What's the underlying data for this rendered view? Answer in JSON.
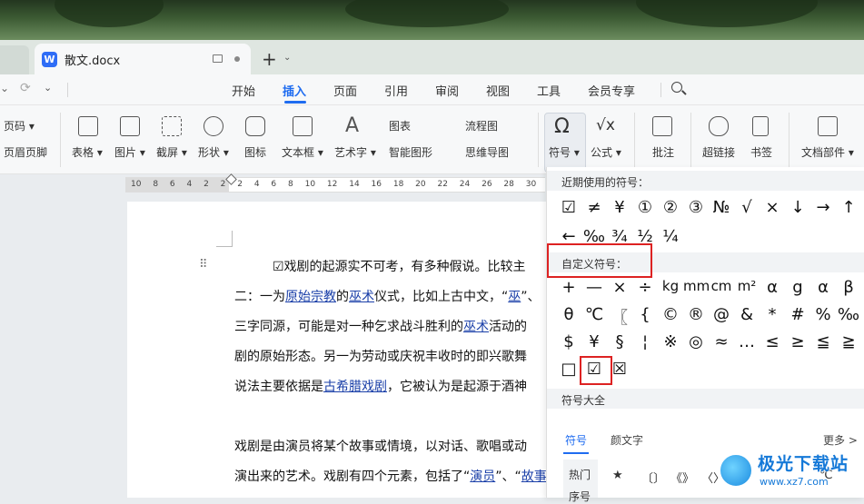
{
  "tab": {
    "app_letter": "W",
    "title": "散文.docx",
    "new_tab": "+",
    "new_tab_arrow": "⌄"
  },
  "menu": {
    "undo": "⌄",
    "redo": "⟳",
    "more": "⌄",
    "items": [
      "开始",
      "插入",
      "页面",
      "引用",
      "审阅",
      "视图",
      "工具",
      "会员专享"
    ],
    "active": "插入"
  },
  "ribbon": {
    "page_num": "页码 ▾",
    "header_footer": "页眉页脚",
    "table": "表格 ▾",
    "picture": "图片 ▾",
    "screenshot": "截屏 ▾",
    "shape": "形状 ▾",
    "icon": "图标",
    "textbox": "文本框 ▾",
    "wordart": "艺术字 ▾",
    "chart": "图表",
    "smartart": "智能图形",
    "flowchart": "流程图",
    "mindmap": "思维导图",
    "symbol": "符号 ▾",
    "formula": "公式 ▾",
    "comment": "批注",
    "hyperlink": "超链接",
    "bookmark": "书签",
    "doc_parts": "文档部件 ▾"
  },
  "ruler": {
    "numbers": "10 8 6 4 2 2 2 4 6 8 10 12 14 16 18 20 22 24 26 28 30 32"
  },
  "document": {
    "line1": "☑戏剧的起源实不可考，有多种假说。比较主",
    "line2_pre": "二：一为",
    "line2_link1": "原始宗教",
    "line2_mid": "的",
    "line2_link2": "巫术",
    "line2_post": "仪式，比如上古中文，“",
    "line2_link3": "巫",
    "line2_end": "”、",
    "line3_pre": "三字同源，可能是对一种乞求战斗胜利的",
    "line3_link": "巫术",
    "line3_post": "活动的",
    "line4": "剧的原始形态。另一为劳动或庆祝丰收时的即兴歌舞",
    "line5_pre": "说法主要依据是",
    "line5_link": "古希腊戏剧",
    "line5_post": "，它被认为是起源于酒神",
    "line6": "戏剧是由演员将某个故事或情境，以对话、歌唱或动",
    "line7_pre": "演出来的艺术。戏剧有四个元素，包括了“",
    "line7_link1": "演员",
    "line7_mid": "”、“",
    "line7_link2": "故事"
  },
  "panel": {
    "recent_title": "近期使用的符号：",
    "recent_row1": [
      "☑",
      "≠",
      "¥",
      "①",
      "②",
      "③",
      "№",
      "√",
      "×",
      "↓",
      "→",
      "↑"
    ],
    "recent_row2": [
      "←",
      "‰",
      "¾",
      "½",
      "¼"
    ],
    "custom_title": "自定义符号：",
    "custom_row1": [
      "+",
      "—",
      "×",
      "÷",
      "kg",
      "mm",
      "cm",
      "m²",
      "α",
      "g",
      "α",
      "β"
    ],
    "custom_row2": [
      "θ",
      "℃",
      "〖",
      "{",
      "©",
      "®",
      "@",
      "&",
      "*",
      "#",
      "%",
      "‰"
    ],
    "custom_row3": [
      "$",
      "¥",
      "§",
      "¦",
      "※",
      "◎",
      "≈",
      "…",
      "≤",
      "≥",
      "≦",
      "≧"
    ],
    "custom_row4": [
      "□",
      "☑",
      "☒"
    ],
    "all_title": "符号大全",
    "tab_symbol": "符号",
    "tab_emoticon": "颜文字",
    "more": "更多 >",
    "cat_hot": "热门",
    "cat_next": "序号",
    "grid": [
      "★",
      "〔〕",
      "《》",
      "〈〉",
      "…",
      "℃"
    ]
  },
  "watermark": {
    "title": "极光下载站",
    "url": "www.xz7.com"
  },
  "colors": {
    "accent": "#1f6cf0",
    "highlight": "#dd2222"
  }
}
